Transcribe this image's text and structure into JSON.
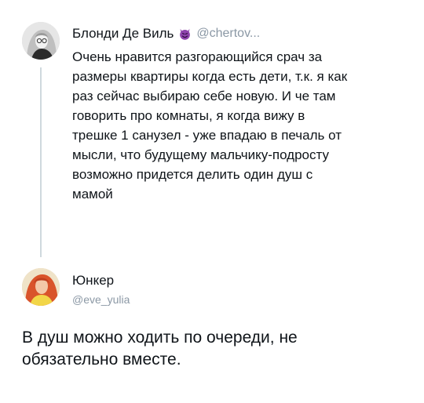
{
  "original_tweet": {
    "author_name": "Блонди Де Виль",
    "author_emoji_icon": "smiling-devil-icon",
    "handle": "@chertov...",
    "text_lines": [
      "Очень нравится разгорающийся срач за",
      "размеры квартиры когда есть дети, т.к. я как",
      "раз сейчас выбираю себе новую. И че там",
      "говорить про комнаты, я когда вижу в",
      "трешке 1 санузел - уже впадаю в печаль от",
      "мысли, что будущему мальчику-подросту",
      "возможно придется делить один душ с",
      "мамой"
    ]
  },
  "reply_tweet": {
    "author_name": "Юнкер",
    "handle": "@eve_yulia",
    "text_lines": [
      "В душ можно ходить по очереди, не",
      "обязательно вместе."
    ]
  },
  "colors": {
    "text": "#0f1419",
    "secondary_text": "#8b98a5",
    "thread_line": "#cfd9de",
    "emoji_purple": "#8e44ad"
  }
}
